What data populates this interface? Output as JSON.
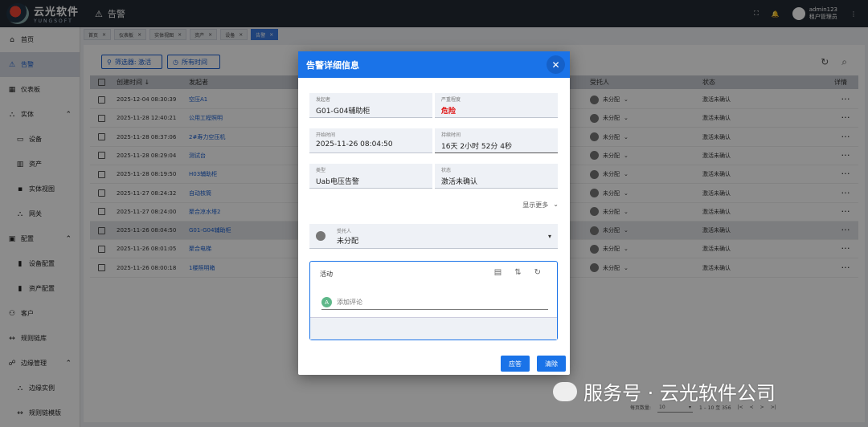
{
  "brand": {
    "name": "云光软件",
    "sub": "YUNGSOFT"
  },
  "page_title": "告警",
  "user": {
    "name": "admin123",
    "role": "租户管理员"
  },
  "nav": [
    {
      "label": "首页",
      "icon": "home-icon",
      "type": "item"
    },
    {
      "label": "告警",
      "icon": "warning-icon",
      "type": "item",
      "active": true
    },
    {
      "label": "仪表板",
      "icon": "dashboard-icon",
      "type": "item"
    },
    {
      "label": "实体",
      "icon": "entity-icon",
      "type": "group"
    },
    {
      "label": "设备",
      "icon": "device-icon",
      "type": "sub"
    },
    {
      "label": "资产",
      "icon": "asset-icon",
      "type": "sub"
    },
    {
      "label": "实体视图",
      "icon": "view-icon",
      "type": "sub"
    },
    {
      "label": "网关",
      "icon": "gateway-icon",
      "type": "sub"
    },
    {
      "label": "配置",
      "icon": "config-icon",
      "type": "group"
    },
    {
      "label": "设备配置",
      "icon": "device-config-icon",
      "type": "sub"
    },
    {
      "label": "资产配置",
      "icon": "asset-config-icon",
      "type": "sub"
    },
    {
      "label": "客户",
      "icon": "customers-icon",
      "type": "item"
    },
    {
      "label": "规则链库",
      "icon": "rule-chain-icon",
      "type": "item"
    },
    {
      "label": "边缘管理",
      "icon": "edge-icon",
      "type": "group"
    },
    {
      "label": "边缘实例",
      "icon": "edge-instance-icon",
      "type": "sub"
    },
    {
      "label": "规则链模版",
      "icon": "rule-template-icon",
      "type": "sub"
    }
  ],
  "tabs": [
    "首页",
    "仪表板",
    "实体视图",
    "资产",
    "设备",
    "告警"
  ],
  "filters": {
    "filter_label": "筛选器: 激活",
    "time_label": "所有时间"
  },
  "table": {
    "headers": {
      "time": "创建时间 ↓",
      "source": "发起者",
      "assignee": "受托人",
      "status": "状态",
      "details": "详情"
    },
    "rows": [
      {
        "time": "2025-12-04 08:30:39",
        "source": "空压A1",
        "assignee": "未分配",
        "status": "激活未确认"
      },
      {
        "time": "2025-11-28 12:40:21",
        "source": "公用工程照明",
        "assignee": "未分配",
        "status": "激活未确认"
      },
      {
        "time": "2025-11-28 08:37:06",
        "source": "2#寿力空压机",
        "assignee": "未分配",
        "status": "激活未确认"
      },
      {
        "time": "2025-11-28 08:29:04",
        "source": "测试台",
        "assignee": "未分配",
        "status": "激活未确认"
      },
      {
        "time": "2025-11-28 08:19:50",
        "source": "H03辅助柜",
        "assignee": "未分配",
        "status": "激活未确认"
      },
      {
        "time": "2025-11-27 08:24:32",
        "source": "自动核筒",
        "assignee": "未分配",
        "status": "激活未确认"
      },
      {
        "time": "2025-11-27 08:24:00",
        "source": "聚合凉水塔2",
        "assignee": "未分配",
        "status": "激活未确认"
      },
      {
        "time": "2025-11-26 08:04:50",
        "source": "G01-G04辅助柜",
        "assignee": "未分配",
        "status": "激活未确认"
      },
      {
        "time": "2025-11-26 08:01:05",
        "source": "聚合电梯",
        "assignee": "未分配",
        "status": "激活未确认"
      },
      {
        "time": "2025-11-26 08:00:18",
        "source": "1楼照明箱",
        "assignee": "未分配",
        "status": "激活未确认"
      }
    ]
  },
  "pager": {
    "per_page_label": "每页数量:",
    "per_page": "10",
    "range": "1 – 10 至 356"
  },
  "dialog": {
    "title": "告警详细信息",
    "originator_label": "发起者",
    "originator": "G01-G04辅助柜",
    "severity_label": "严重程度",
    "severity": "危险",
    "start_label": "开始时间",
    "start": "2025-11-26 08:04:50",
    "duration_label": "持续时间",
    "duration": "16天 2小时 52分 4秒",
    "type_label": "类型",
    "type": "Uab电压告警",
    "status_label": "状态",
    "status": "激活未确认",
    "show_more": "显示更多",
    "assignee_label": "受托人",
    "assignee": "未分配",
    "activity_title": "活动",
    "comment_avatar": "A",
    "comment_placeholder": "添加评论",
    "ack_button": "应答",
    "clear_button": "清除"
  },
  "watermark": "服务号 · 云光软件公司"
}
